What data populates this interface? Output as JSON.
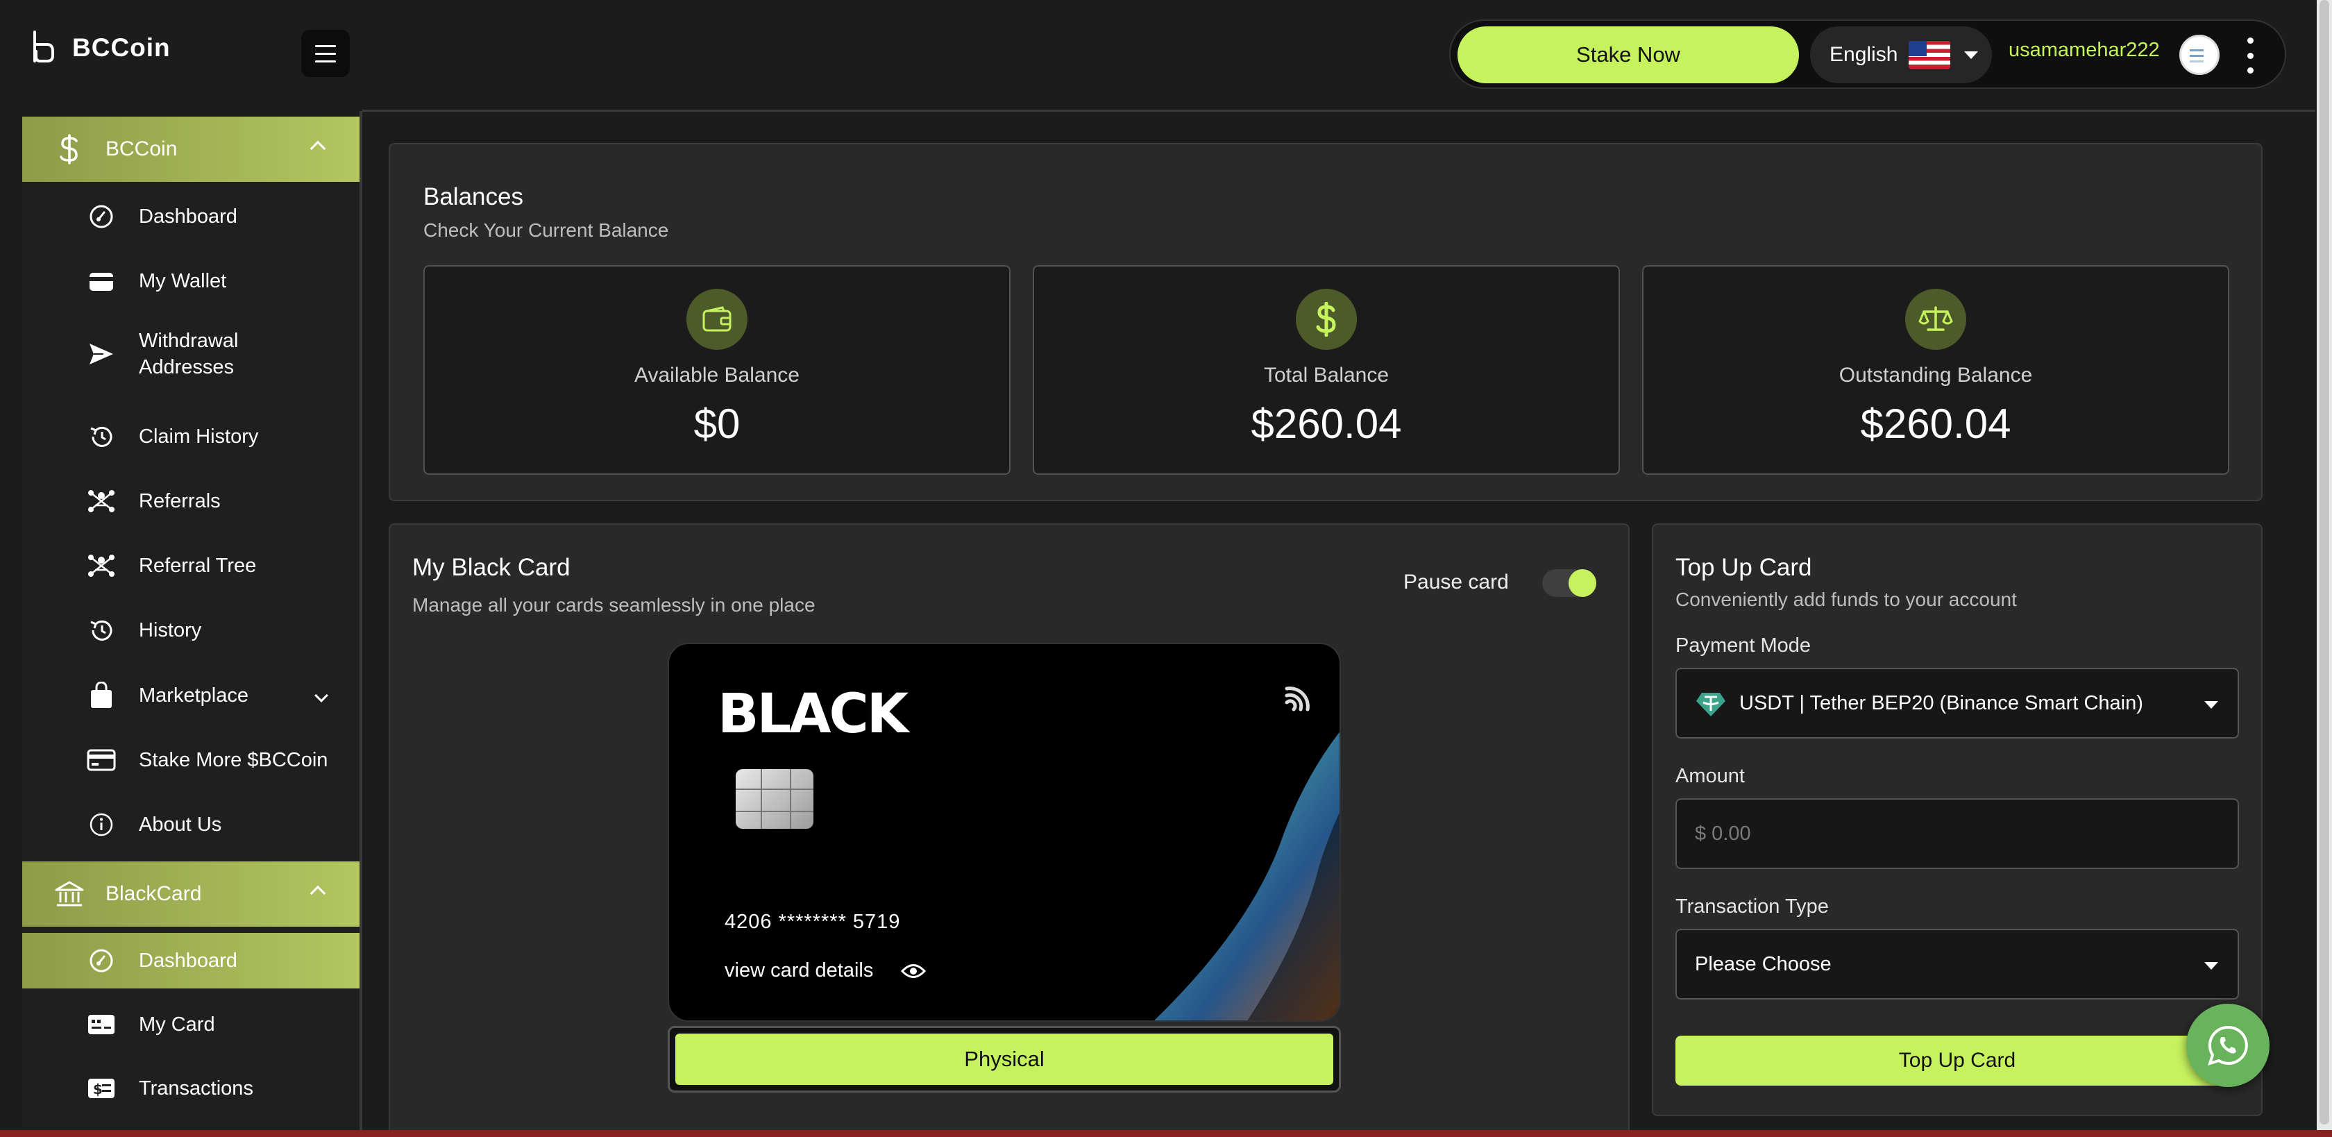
{
  "brand": {
    "name": "BCCoin"
  },
  "topbar": {
    "stake_label": "Stake Now",
    "language": "English",
    "username": "usamamehar222"
  },
  "sidebar": {
    "sections": [
      {
        "label": "BCCoin",
        "items": [
          {
            "label": "Dashboard",
            "icon": "speedometer-icon"
          },
          {
            "label": "My Wallet",
            "icon": "wallet-icon"
          },
          {
            "label": "Withdrawal Addresses",
            "icon": "send-icon"
          },
          {
            "label": "Claim History",
            "icon": "history-icon"
          },
          {
            "label": "Referrals",
            "icon": "network-icon"
          },
          {
            "label": "Referral Tree",
            "icon": "network-icon"
          },
          {
            "label": "History",
            "icon": "history-icon"
          },
          {
            "label": "Marketplace",
            "icon": "shopping-bag-icon"
          },
          {
            "label": "Stake More $BCCoin",
            "icon": "credit-card-icon"
          },
          {
            "label": "About Us",
            "icon": "info-icon"
          }
        ]
      },
      {
        "label": "BlackCard",
        "items": [
          {
            "label": "Dashboard",
            "icon": "speedometer-icon",
            "active": true
          },
          {
            "label": "My Card",
            "icon": "id-card-icon"
          },
          {
            "label": "Transactions",
            "icon": "money-list-icon"
          }
        ]
      }
    ]
  },
  "balances": {
    "title": "Balances",
    "subtitle": "Check Your Current Balance",
    "cards": [
      {
        "label": "Available Balance",
        "value": "$0",
        "icon": "wallet-icon"
      },
      {
        "label": "Total Balance",
        "value": "$260.04",
        "icon": "dollar-icon"
      },
      {
        "label": "Outstanding Balance",
        "value": "$260.04",
        "icon": "scale-icon"
      }
    ]
  },
  "black_card": {
    "title": "My Black Card",
    "subtitle": "Manage all your cards seamlessly in one place",
    "pause_label": "Pause card",
    "card_brand": "BLACK",
    "card_number": "4206 ******** 5719",
    "view_details": "view card details",
    "physical_label": "Physical"
  },
  "top_up": {
    "title": "Top Up Card",
    "subtitle": "Conveniently add funds to your account",
    "payment_mode_label": "Payment Mode",
    "payment_mode_value": "USDT | Tether BEP20 (Binance Smart Chain)",
    "amount_label": "Amount",
    "amount_placeholder": "$ 0.00",
    "transaction_type_label": "Transaction Type",
    "transaction_type_value": "Please Choose",
    "button_label": "Top Up Card"
  },
  "colors": {
    "accent": "#c6f25e",
    "sidebar_active": "#a4b556",
    "background": "#1c1c1c",
    "panel": "#292929"
  }
}
